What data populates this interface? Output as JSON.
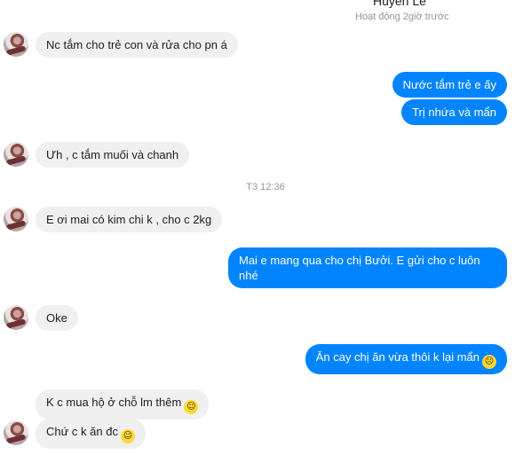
{
  "header": {
    "name": "Huyền Lê",
    "status": "Hoạt động 2giờ trước"
  },
  "messages": {
    "m1": "Nc tắm cho trẻ con và rửa cho pn á",
    "m2": "Nước tắm trẻ e ấy",
    "m3": "Trị nhứa và mẩn",
    "m4": "Ưh , c tắm muối và chanh",
    "timestamp": "T3 12:36",
    "m5": "E ơi mai có kim chi k , cho c 2kg",
    "m6": "Mai e mang qua cho chị Bưởi. E gửi cho c luôn nhé",
    "m7": "Oke",
    "m8": "Ăn cay chị ăn vừa thôi k lại mẩn",
    "m9": "K c mua hộ ở chỗ lm thêm",
    "m10": "Chứ c k ăn đc"
  },
  "emojis": {
    "sad": {
      "name": "disappointed-face-emoji",
      "glyph": "☹"
    },
    "grin": {
      "name": "grinning-face-emoji",
      "glyph": "☺"
    },
    "sweat": {
      "name": "grinning-sweat-face-emoji",
      "glyph": "☺"
    }
  },
  "colors": {
    "outgoing": "#0084ff",
    "incoming": "#f1f0f0"
  }
}
